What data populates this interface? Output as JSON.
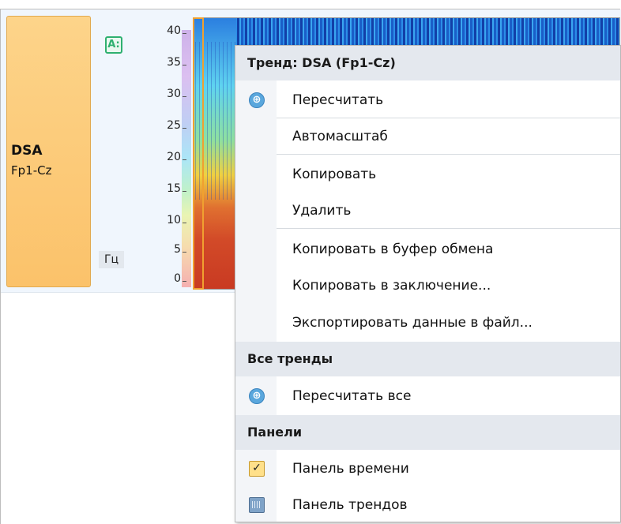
{
  "channel": {
    "name": "DSA",
    "lead": "Fp1-Cz"
  },
  "axis": {
    "auto_label": "A:",
    "unit": "Гц",
    "ticks": [
      "40",
      "35",
      "30",
      "25",
      "20",
      "15",
      "10",
      "5",
      "0"
    ]
  },
  "menu": {
    "trend_header": "Тренд: DSA (Fp1-Cz)",
    "trend_items": [
      {
        "label": "Пересчитать",
        "icon": "recalc-icon"
      },
      {
        "label": "Автомасштаб"
      },
      {
        "label": "Копировать"
      },
      {
        "label": "Удалить"
      },
      {
        "label": "Копировать в буфер обмена"
      },
      {
        "label": "Копировать в заключение..."
      },
      {
        "label": "Экспортировать данные в файл..."
      }
    ],
    "all_header": "Все тренды",
    "all_items": [
      {
        "label": "Пересчитать все",
        "icon": "recalc-icon"
      }
    ],
    "panels_header": "Панели",
    "panel_items": [
      {
        "label": "Панель времени",
        "icon": "check-icon",
        "checked": true
      },
      {
        "label": "Панель трендов",
        "icon": "panel-icon"
      }
    ]
  }
}
